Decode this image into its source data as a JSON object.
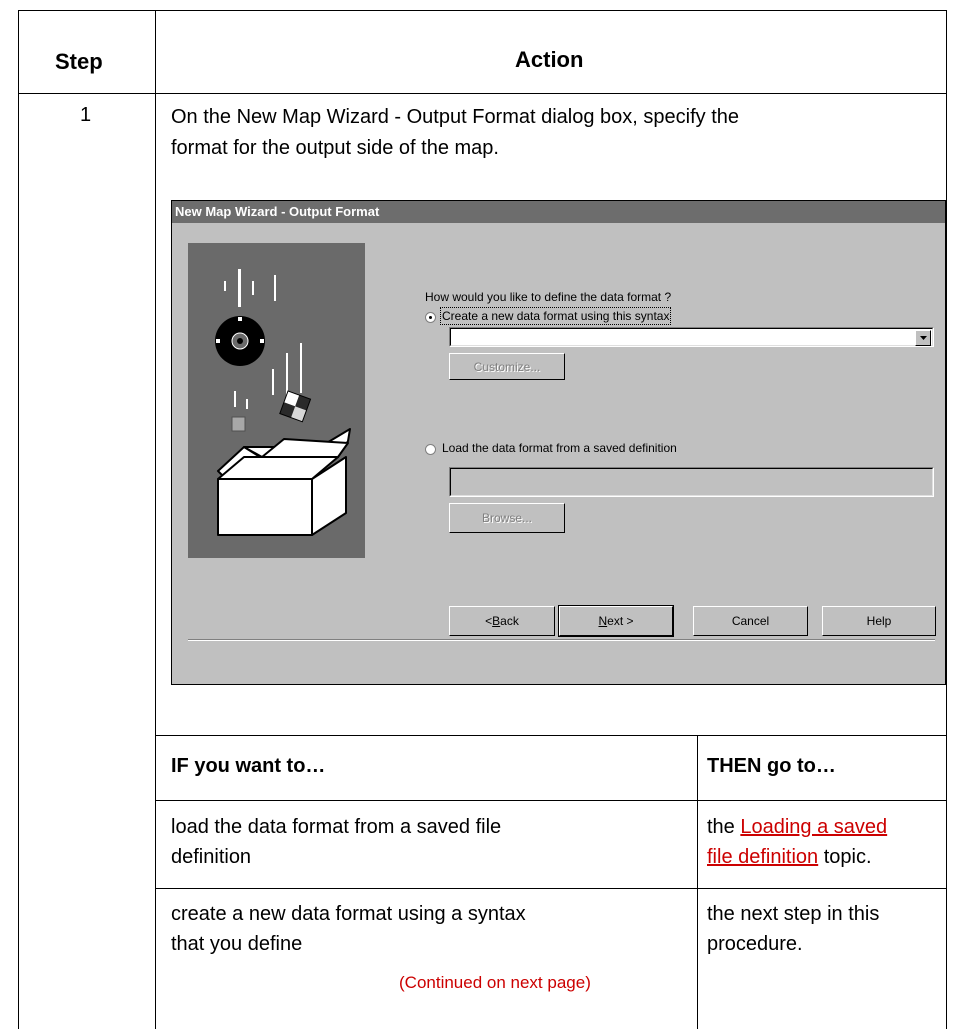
{
  "table": {
    "header_step": "Step",
    "header_action": "Action",
    "step_number": "1",
    "instruction_line1": "On the New Map Wizard - Output Format dialog box, specify the",
    "instruction_line2": "format for the output side of the map."
  },
  "dialog": {
    "title": "New Map Wizard - Output Format",
    "question": "How would you like to define the data format ?",
    "option_create": "Create a new data format using this syntax",
    "option_create_selected": true,
    "syntax_value": "",
    "customize_label": "Customize...",
    "option_load": "Load the data format from a saved definition",
    "option_load_selected": false,
    "saved_definition_value": "",
    "browse_label": "Browse...",
    "back_prefix": "< ",
    "back_underline": "B",
    "back_rest": "ack",
    "next_underline": "N",
    "next_rest": "ext >",
    "cancel_label": "Cancel",
    "help_label": "Help",
    "icons": {
      "dropdown_arrow": "chevron-down-icon",
      "illustration": "wizard-box-illustration"
    }
  },
  "decision_table": {
    "header_if": "IF you want to…",
    "header_then": "THEN go to…",
    "rows": [
      {
        "if_line1": "load the data format from a saved file",
        "if_line2": "definition",
        "then_prefix": "the ",
        "then_link_line1": "Loading a saved",
        "then_link_line2": "file definition",
        "then_suffix": " topic."
      },
      {
        "if_line1": "create a new data format using a syntax",
        "if_line2": "that you define",
        "then_line1": "the next step in this",
        "then_line2": "procedure."
      }
    ],
    "continued": "(Continued on next page)"
  },
  "colors": {
    "dialog_face": "#c0c0c0",
    "titlebar": "#6d6d6d",
    "link": "#cc0000"
  }
}
